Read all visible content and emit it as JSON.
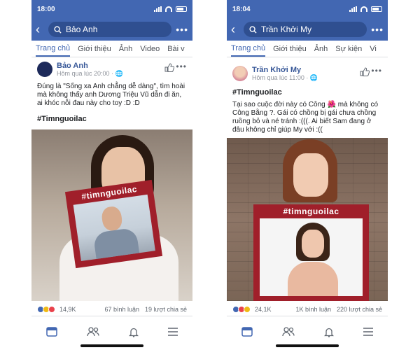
{
  "phones": [
    {
      "time": "18:00",
      "search_value": "Bảo Anh",
      "tabs": [
        "Trang chủ",
        "Giới thiệu",
        "Ảnh",
        "Video",
        "Bài v"
      ],
      "author": "Bảo Anh",
      "timestamp": "Hôm qua lúc 20:00 ·",
      "text": "Đúng là \"Sống xa Anh chẳng dễ dàng\", tìm hoài mà không thấy anh Dương Triệu Vũ dẫn đi ăn, ai khóc nỗi đau này cho toy :D :D",
      "hashtag": "#Timnguoilac",
      "sign_text": "#timnguoilac",
      "reactions": "14,9K",
      "comments": "67 bình luận",
      "shares": "19 lượt chia sẻ"
    },
    {
      "time": "18:04",
      "search_value": "Trần Khởi My",
      "tabs": [
        "Trang chủ",
        "Giới thiệu",
        "Ảnh",
        "Sự kiện",
        "Vi"
      ],
      "author": "Trần Khởi My",
      "timestamp": "Hôm qua lúc 11:00 ·",
      "text": "Tại sao cuộc đời này có Công 🌺 mà không có Công Bằng ?. Gái có chồng bị gái chưa chồng ruồng bỏ và né tránh :(((. Ai biết Sam đang ở đâu không chỉ giúp My với :((",
      "hashtag": "#Timnguoilac",
      "sign_text": "#timnguoilac",
      "reactions": "24,1K",
      "comments": "1K bình luận",
      "shares": "220 lượt chia sẻ"
    }
  ],
  "colors": {
    "brand": "#4267b2",
    "sign": "#a01f2a",
    "link": "#385898"
  },
  "icons": [
    "back-arrow-icon",
    "search-icon",
    "more-icon",
    "like-icon",
    "globe-icon",
    "feed-icon",
    "friends-icon",
    "bell-icon",
    "menu-icon"
  ]
}
